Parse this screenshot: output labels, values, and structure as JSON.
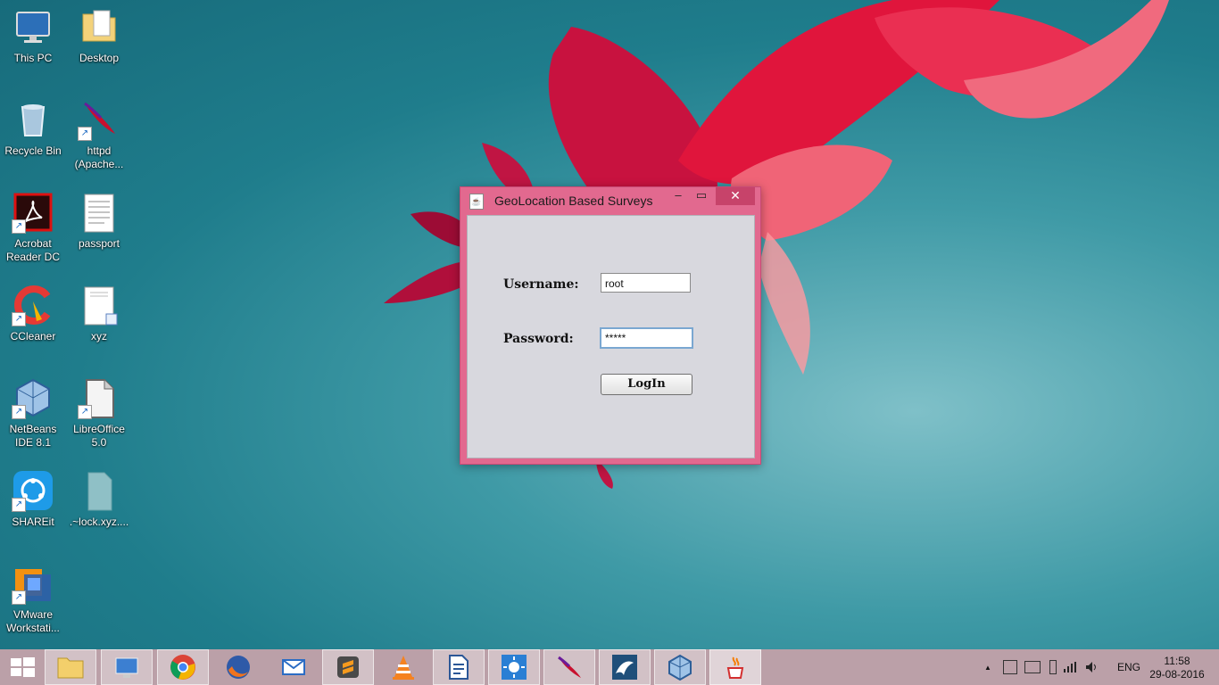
{
  "desktop": {
    "icons": [
      {
        "label": "This PC"
      },
      {
        "label": "Desktop"
      },
      {
        "label": "Recycle Bin"
      },
      {
        "label": "httpd (Apache..."
      },
      {
        "label": "Acrobat Reader DC"
      },
      {
        "label": "passport"
      },
      {
        "label": "CCleaner"
      },
      {
        "label": "xyz"
      },
      {
        "label": "NetBeans IDE 8.1"
      },
      {
        "label": "LibreOffice 5.0"
      },
      {
        "label": "SHAREit"
      },
      {
        "label": ".~lock.xyz...."
      },
      {
        "label": "VMware Workstati..."
      }
    ]
  },
  "window": {
    "title": "GeoLocation Based Surveys",
    "minimize": "–",
    "maximize": "▭",
    "close": "✕",
    "username_label": "Username:",
    "username_value": "root",
    "password_label": "Password:",
    "password_value": "*****",
    "login_label": "LogIn"
  },
  "taskbar": {
    "language": "ENG",
    "time": "11:58",
    "date": "29-08-2016",
    "tray_arrow": "▲"
  }
}
